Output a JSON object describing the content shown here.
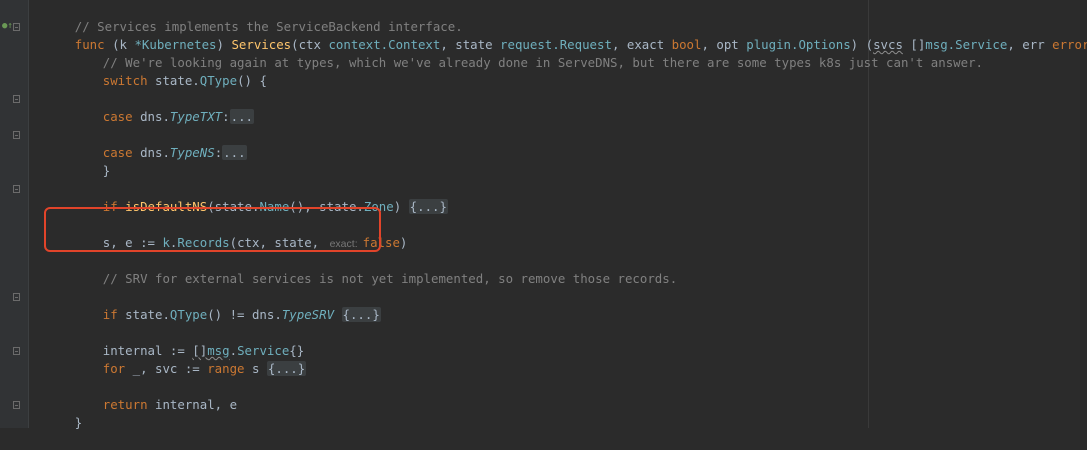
{
  "code": {
    "line1": "// Services implements the ServiceBackend interface.",
    "line2": {
      "kw_func": "func",
      "p1": " (k ",
      "recv": "*Kubernetes",
      "p2": ") ",
      "fname": "Services",
      "p3": "(ctx ",
      "ctx_type": "context.Context",
      "p4": ", state ",
      "req_type": "request.Request",
      "p5": ", exact ",
      "bool_type": "bool",
      "p6": ", opt ",
      "opt_type": "plugin.Options",
      "p7": ") (",
      "svcs": "svcs",
      "p8": " []",
      "svc_type": "msg.Service",
      "p9": ", err ",
      "err_type": "error",
      "p10": ") {"
    },
    "line3": "// We're looking again at types, which we've already done in ServeDNS, but there are some types k8s just can't answer.",
    "line4": {
      "kw": "switch",
      "rest1": " state.",
      "fn": "QType",
      "rest2": "() {"
    },
    "line5": {
      "kw": "case",
      "p1": " dns.",
      "type": "TypeTXT",
      "p2": ":",
      "fold": "..."
    },
    "line6": {
      "kw": "case",
      "p1": " dns.",
      "type": "TypeNS",
      "p2": ":",
      "fold": "..."
    },
    "line7": "}",
    "line8": {
      "kw": "if",
      "sp": " ",
      "fn1": "isDefaultNS",
      "p1": "(state.",
      "fn2": "Name",
      "p2": "(), state.",
      "fld": "Zone",
      "p3": ") ",
      "fold": "{...}"
    },
    "line9": {
      "p1": "s, e := ",
      "recv": "k",
      "dot": ".",
      "fn": "Records",
      "p2": "(ctx, state, ",
      "hint": "exact:",
      "kw": "false",
      "p3": ")"
    },
    "line10": "// SRV for external services is not yet implemented, so remove those records.",
    "line11": {
      "kw": "if",
      "p1": " state.",
      "fn": "QType",
      "p2": "() != dns.",
      "type": "TypeSRV",
      "p3": " ",
      "fold": "{...}"
    },
    "line12": {
      "p1": "internal := ",
      "br": "[]",
      "t1": "msg",
      "dot": ".",
      "t2": "Service",
      "p2": "{}"
    },
    "line13": {
      "kw1": "for",
      "p1": " _, svc := ",
      "kw2": "range",
      "p2": " s ",
      "fold": "{...}"
    },
    "line14": {
      "kw": "return",
      "p1": " internal, e"
    },
    "line15": "}"
  },
  "colors": {
    "background": "#2b2b2b",
    "keyword": "#cc7832",
    "function": "#ffc66d",
    "comment": "#808080",
    "type": "#6fafbd",
    "highlight_box": "#e1442a"
  }
}
